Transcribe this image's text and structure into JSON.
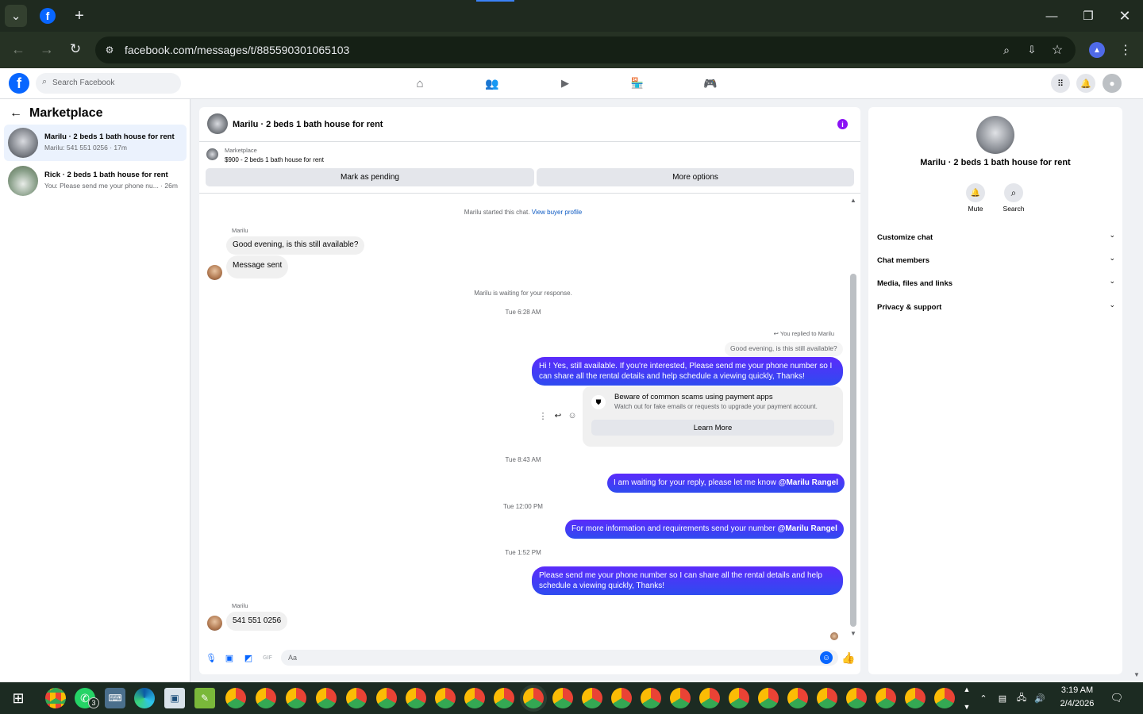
{
  "browser": {
    "url": "facebook.com/messages/t/885590301065103"
  },
  "fb": {
    "search_placeholder": "Search Facebook"
  },
  "left": {
    "title": "Marketplace",
    "items": [
      {
        "name": "Marilu · 2 beds 1 bath house for rent",
        "preview": "Marilu: 541 551 0256 · 17m"
      },
      {
        "name": "Rick · 2 beds 1 bath house for rent",
        "preview": "You: Please send me your phone nu... · 26m"
      }
    ]
  },
  "chat": {
    "title": "Marilu · 2 beds 1 bath house for rent",
    "listing_label": "Marketplace",
    "listing_title": "$900 - 2 beds 1 bath house for rent",
    "mark_pending": "Mark as pending",
    "more_options": "More options",
    "started_prefix": "Marilu started this chat.",
    "view_buyer": "View buyer profile",
    "sender1": "Marilu",
    "msg1": "Good evening, is this still available?",
    "msg2": "Message sent",
    "waiting": "Marilu is waiting for your response.",
    "ts1": "Tue 6:28 AM",
    "replied": "You replied to Marilu",
    "quoted": "Good evening, is this still available?",
    "out1": "Hi ! Yes, still available. If you're interested, Please send me your phone number so I can share all the rental details and help schedule a viewing quickly, Thanks!",
    "scam_title": "Beware of common scams using payment apps",
    "scam_body": "Watch out for fake emails or requests to upgrade your payment account.",
    "learn_more": "Learn More",
    "ts2": "Tue 8:43 AM",
    "out2": "I am waiting for your reply, please let me know",
    "mention": "@Marilu Rangel",
    "ts3": "Tue 12:00 PM",
    "out3": "For more information and requirements send your number",
    "ts4": "Tue 1:52 PM",
    "out4": "Please send me your phone number so I can share all the rental details and help schedule a viewing quickly, Thanks!",
    "sender2": "Marilu",
    "msg3": "541 551 0256",
    "input_placeholder": "Aa"
  },
  "right": {
    "title": "Marilu · 2 beds 1 bath house for rent",
    "mute": "Mute",
    "search": "Search",
    "sections": [
      "Customize chat",
      "Chat members",
      "Media, files and links",
      "Privacy & support"
    ]
  },
  "taskbar": {
    "time": "3:19 AM",
    "date": "2/4/2026",
    "badge": "3"
  },
  "colors": {
    "accent": "#0866ff",
    "bubble": "#3d3dff"
  }
}
